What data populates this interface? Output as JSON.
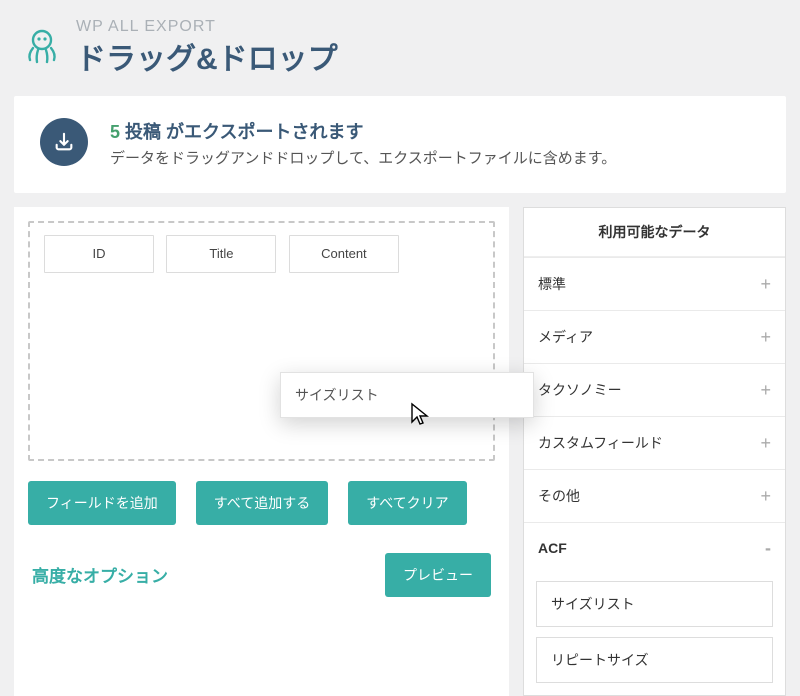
{
  "header": {
    "small": "WP ALL EXPORT",
    "title": "ドラッグ&ドロップ"
  },
  "banner": {
    "count": "5",
    "count_suffix": " 投稿 がエクスポートされます",
    "subtext": "データをドラッグアンドドロップして、エクスポートファイルに含めます。"
  },
  "dropzone": {
    "fields": [
      "ID",
      "Title",
      "Content"
    ]
  },
  "buttons": {
    "add_field": "フィールドを追加",
    "add_all": "すべて追加する",
    "clear_all": "すべてクリア"
  },
  "advanced": {
    "label": "高度なオプション",
    "preview": "プレビュー"
  },
  "sidebar": {
    "header": "利用可能なデータ",
    "sections": [
      {
        "label": "標準",
        "toggle": "+"
      },
      {
        "label": "メディア",
        "toggle": "+"
      },
      {
        "label": "タクソノミー",
        "toggle": "+"
      },
      {
        "label": "カスタムフィールド",
        "toggle": "+"
      },
      {
        "label": "その他",
        "toggle": "+"
      },
      {
        "label": "ACF",
        "toggle": "-"
      }
    ],
    "acf_fields": [
      "サイズリスト",
      "リピートサイズ"
    ]
  },
  "drag_ghost": "サイズリスト"
}
